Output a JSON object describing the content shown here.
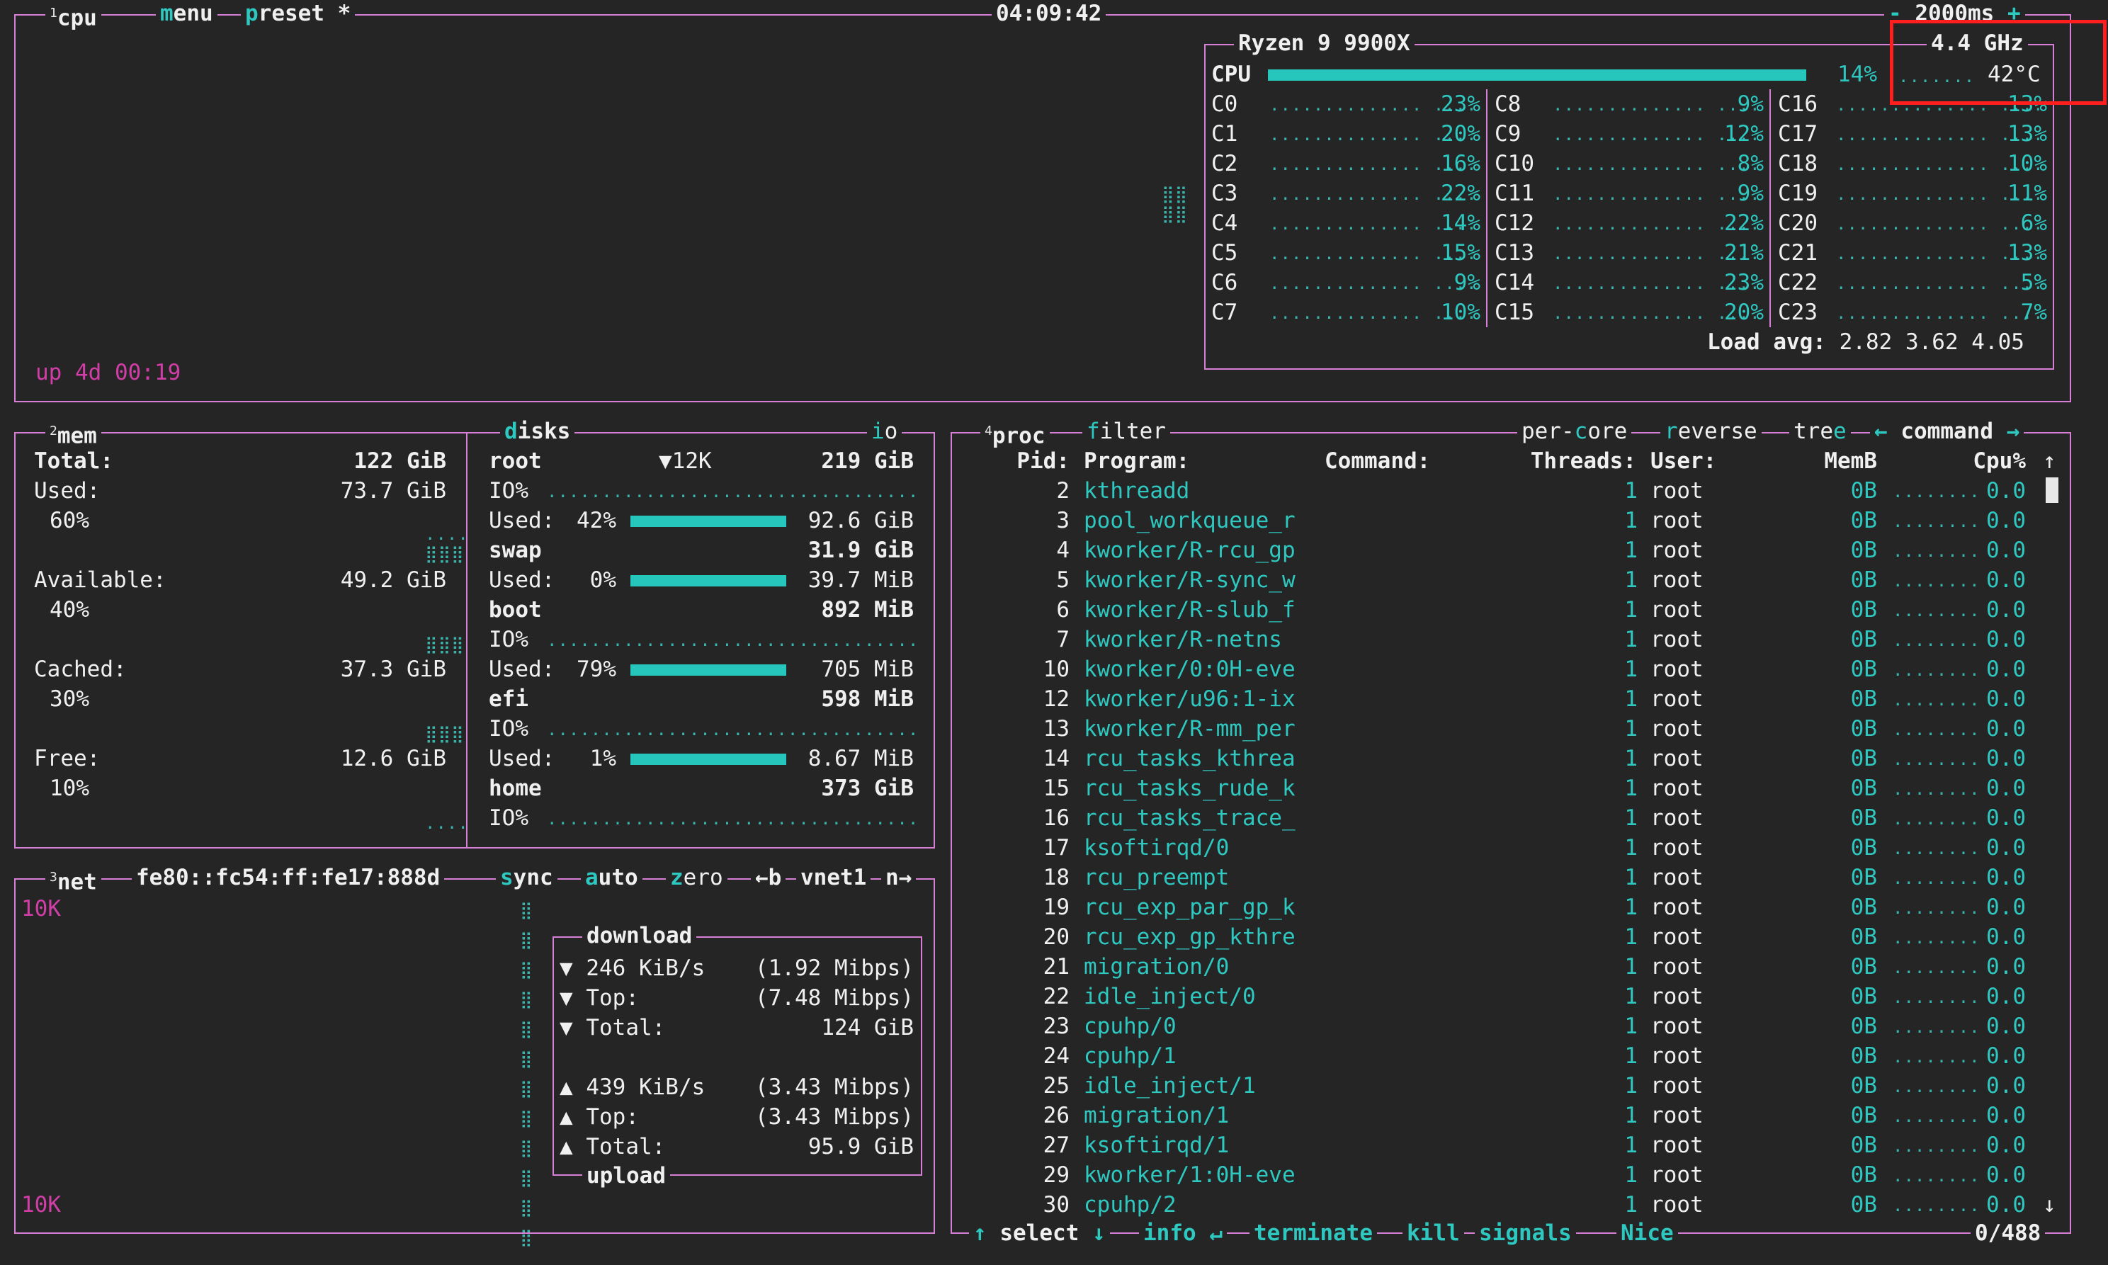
{
  "cpu_box": {
    "num": "1",
    "title": "cpu",
    "menu": "menu",
    "preset": "preset *",
    "clock": "04:09:42",
    "interval_minus": "-",
    "interval": "2000ms",
    "interval_plus": "+",
    "uptime": "up 4d 00:19",
    "model": "Ryzen 9 9900X",
    "freq": "4.4 GHz",
    "temp": "42°C",
    "total_label": "CPU",
    "total_pct": "14%",
    "total_fraction": 0.14,
    "cores": [
      [
        "C0",
        "23%"
      ],
      [
        "C1",
        "20%"
      ],
      [
        "C2",
        "16%"
      ],
      [
        "C3",
        "22%"
      ],
      [
        "C4",
        "14%"
      ],
      [
        "C5",
        "15%"
      ],
      [
        "C6",
        "9%"
      ],
      [
        "C7",
        "10%"
      ],
      [
        "C8",
        "9%"
      ],
      [
        "C9",
        "12%"
      ],
      [
        "C10",
        "8%"
      ],
      [
        "C11",
        "9%"
      ],
      [
        "C12",
        "22%"
      ],
      [
        "C13",
        "21%"
      ],
      [
        "C14",
        "23%"
      ],
      [
        "C15",
        "20%"
      ],
      [
        "C16",
        "13%"
      ],
      [
        "C17",
        "13%"
      ],
      [
        "C18",
        "10%"
      ],
      [
        "C19",
        "11%"
      ],
      [
        "C20",
        "6%"
      ],
      [
        "C21",
        "13%"
      ],
      [
        "C22",
        "5%"
      ],
      [
        "C23",
        "7%"
      ]
    ],
    "load_label": "Load avg:",
    "load": "2.82 3.62 4.05"
  },
  "mem": {
    "num": "2",
    "title": "mem",
    "total_label": "Total:",
    "total": "122 GiB",
    "used_label": "Used:",
    "used": "73.7 GiB",
    "used_pct": "60%",
    "avail_label": "Available:",
    "avail": "49.2 GiB",
    "avail_pct": "40%",
    "cached_label": "Cached:",
    "cached": "37.3 GiB",
    "cached_pct": "30%",
    "free_label": "Free:",
    "free": "12.6 GiB",
    "free_pct": "10%"
  },
  "disks": {
    "title": "disks",
    "io": "io",
    "items": [
      {
        "name": "root",
        "io_speed": "▼12K",
        "size": "219 GiB",
        "io_label": "IO%",
        "used_label": "Used:",
        "used_pct": "42%",
        "used_val": "92.6 GiB"
      },
      {
        "name": "swap",
        "size": "31.9 GiB",
        "used_label": "Used:",
        "used_pct": "0%",
        "used_val": "39.7 MiB"
      },
      {
        "name": "boot",
        "size": "892 MiB",
        "io_label": "IO%",
        "used_label": "Used:",
        "used_pct": "79%",
        "used_val": "705 MiB"
      },
      {
        "name": "efi",
        "size": "598 MiB",
        "io_label": "IO%",
        "used_label": "Used:",
        "used_pct": "1%",
        "used_val": "8.67 MiB"
      },
      {
        "name": "home",
        "size": "373 GiB",
        "io_label": "IO%"
      }
    ]
  },
  "net": {
    "num": "3",
    "title": "net",
    "addr": "fe80::fc54:ff:fe17:888d",
    "sync": "sync",
    "auto": "auto",
    "zero": "zero",
    "prev": "←b",
    "iface": "vnet1",
    "next": "n→",
    "scale_top": "10K",
    "scale_bottom": "10K",
    "download_title": "download",
    "upload_title": "upload",
    "down_rate": "246 KiB/s",
    "down_rate_bits": "(1.92 Mibps)",
    "down_top_label": "Top:",
    "down_top": "(7.48 Mibps)",
    "down_total_label": "Total:",
    "down_total": "124 GiB",
    "up_rate": "439 KiB/s",
    "up_rate_bits": "(3.43 Mibps)",
    "up_top_label": "Top:",
    "up_top": "(3.43 Mibps)",
    "up_total_label": "Total:",
    "up_total": "95.9 GiB"
  },
  "proc": {
    "num": "4",
    "title": "proc",
    "filter": "filter",
    "per_core": "per-core",
    "reverse": "reverse",
    "tree": "tree",
    "sort_prev": "←",
    "sort": "command",
    "sort_next": "→",
    "headers": {
      "pid": "Pid:",
      "program": "Program:",
      "command": "Command:",
      "threads": "Threads:",
      "user": "User:",
      "mem": "MemB",
      "cpu": "Cpu%"
    },
    "rows": [
      [
        "2",
        "kthreadd",
        "1",
        "root",
        "0B",
        "0.0"
      ],
      [
        "3",
        "pool_workqueue_r",
        "1",
        "root",
        "0B",
        "0.0"
      ],
      [
        "4",
        "kworker/R-rcu_gp",
        "1",
        "root",
        "0B",
        "0.0"
      ],
      [
        "5",
        "kworker/R-sync_w",
        "1",
        "root",
        "0B",
        "0.0"
      ],
      [
        "6",
        "kworker/R-slub_f",
        "1",
        "root",
        "0B",
        "0.0"
      ],
      [
        "7",
        "kworker/R-netns",
        "1",
        "root",
        "0B",
        "0.0"
      ],
      [
        "10",
        "kworker/0:0H-eve",
        "1",
        "root",
        "0B",
        "0.0"
      ],
      [
        "12",
        "kworker/u96:1-ix",
        "1",
        "root",
        "0B",
        "0.0"
      ],
      [
        "13",
        "kworker/R-mm_per",
        "1",
        "root",
        "0B",
        "0.0"
      ],
      [
        "14",
        "rcu_tasks_kthrea",
        "1",
        "root",
        "0B",
        "0.0"
      ],
      [
        "15",
        "rcu_tasks_rude_k",
        "1",
        "root",
        "0B",
        "0.0"
      ],
      [
        "16",
        "rcu_tasks_trace_",
        "1",
        "root",
        "0B",
        "0.0"
      ],
      [
        "17",
        "ksoftirqd/0",
        "1",
        "root",
        "0B",
        "0.0"
      ],
      [
        "18",
        "rcu_preempt",
        "1",
        "root",
        "0B",
        "0.0"
      ],
      [
        "19",
        "rcu_exp_par_gp_k",
        "1",
        "root",
        "0B",
        "0.0"
      ],
      [
        "20",
        "rcu_exp_gp_kthre",
        "1",
        "root",
        "0B",
        "0.0"
      ],
      [
        "21",
        "migration/0",
        "1",
        "root",
        "0B",
        "0.0"
      ],
      [
        "22",
        "idle_inject/0",
        "1",
        "root",
        "0B",
        "0.0"
      ],
      [
        "23",
        "cpuhp/0",
        "1",
        "root",
        "0B",
        "0.0"
      ],
      [
        "24",
        "cpuhp/1",
        "1",
        "root",
        "0B",
        "0.0"
      ],
      [
        "25",
        "idle_inject/1",
        "1",
        "root",
        "0B",
        "0.0"
      ],
      [
        "26",
        "migration/1",
        "1",
        "root",
        "0B",
        "0.0"
      ],
      [
        "27",
        "ksoftirqd/1",
        "1",
        "root",
        "0B",
        "0.0"
      ],
      [
        "29",
        "kworker/1:0H-eve",
        "1",
        "root",
        "0B",
        "0.0"
      ],
      [
        "30",
        "cpuhp/2",
        "1",
        "root",
        "0B",
        "0.0"
      ]
    ],
    "footer": {
      "up": "↑",
      "select": "select",
      "down": "↓",
      "info": "info",
      "enter": "↵",
      "terminate": "terminate",
      "kill": "kill",
      "signals": "signals",
      "nice": "Nice",
      "count": "0/488"
    },
    "scroll_up": "↑",
    "scroll_down": "↓"
  },
  "colors": {
    "border": "#d77fd7",
    "accent": "#2ec8c0",
    "magenta": "#d23ea7",
    "highlight": "#ff1e1e"
  }
}
